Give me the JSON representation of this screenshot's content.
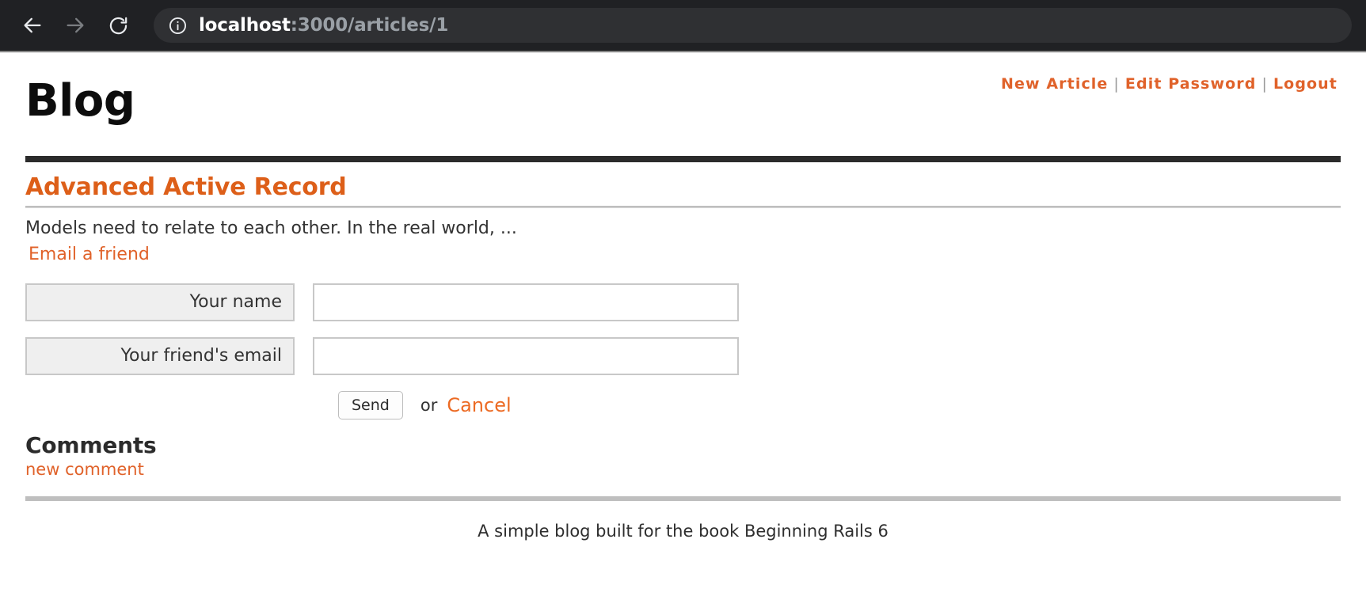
{
  "browser": {
    "back_icon": "back-arrow-icon",
    "forward_icon": "forward-arrow-icon",
    "reload_icon": "reload-icon",
    "site_info_icon": "info-circle-icon",
    "url_host": "localhost",
    "url_path": ":3000/articles/1",
    "url_full": "localhost:3000/articles/1"
  },
  "header": {
    "site_title": "Blog",
    "nav": {
      "new_article": "New Article",
      "separator_1": "|",
      "edit_password": "Edit Password",
      "separator_2": "|",
      "logout": "Logout"
    }
  },
  "article": {
    "title": "Advanced Active Record",
    "body": "Models need to relate to each other. In the real world, ...",
    "email_link": "Email a friend"
  },
  "email_form": {
    "name_label": "Your name",
    "name_value": "",
    "name_placeholder": "",
    "email_label": "Your friend's email",
    "email_value": "",
    "email_placeholder": "",
    "send_label": "Send",
    "or_text": "or",
    "cancel_label": "Cancel"
  },
  "comments": {
    "heading": "Comments",
    "new_comment_link": "new comment"
  },
  "footer": {
    "text": "A simple blog built for the book Beginning Rails 6"
  },
  "colors": {
    "accent_orange": "#e0622a",
    "title_orange": "#dd5f19",
    "chrome_bg": "#202124",
    "omnibox_bg": "#2f3033",
    "rule_dark": "#2b2b2b",
    "rule_footer": "#bfbfbf"
  }
}
